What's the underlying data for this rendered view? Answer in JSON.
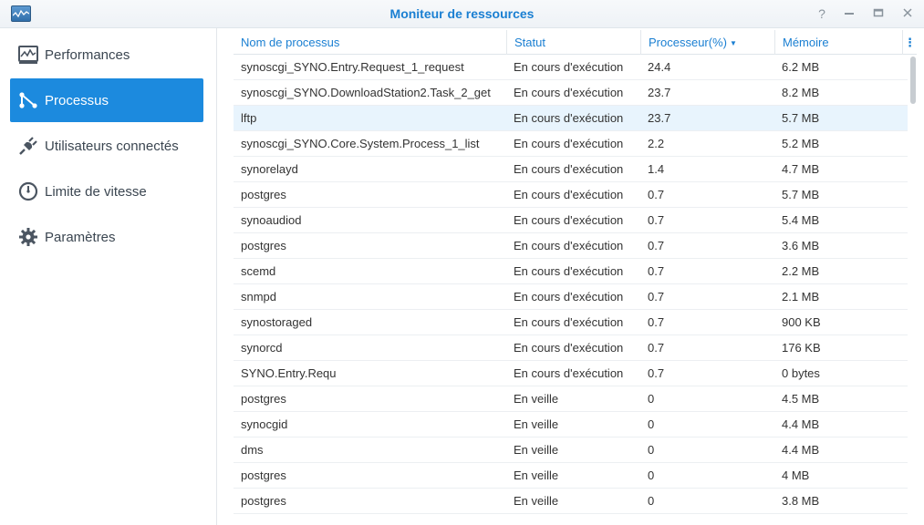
{
  "window": {
    "title": "Moniteur de ressources",
    "controls": [
      "help-icon",
      "minimize-icon",
      "maximize-icon",
      "close-icon"
    ]
  },
  "sidebar": {
    "items": [
      {
        "label": "Performances",
        "icon": "performance-chart-icon",
        "active": false
      },
      {
        "label": "Processus",
        "icon": "process-nodes-icon",
        "active": true
      },
      {
        "label": "Utilisateurs connectés",
        "icon": "plug-icon",
        "active": false
      },
      {
        "label": "Limite de vitesse",
        "icon": "speedometer-icon",
        "active": false
      },
      {
        "label": "Paramètres",
        "icon": "gear-icon",
        "active": false
      }
    ]
  },
  "table": {
    "columns": {
      "name": "Nom de processus",
      "status": "Statut",
      "cpu": "Processeur(%)",
      "memory": "Mémoire",
      "menu": "⋮"
    },
    "sorted_column": "cpu",
    "sort_direction": "descending",
    "rows": [
      {
        "name": "synoscgi_SYNO.Entry.Request_1_request",
        "status": "En cours d'exécution",
        "cpu": "24.4",
        "memory": "6.2 MB"
      },
      {
        "name": "synoscgi_SYNO.DownloadStation2.Task_2_get",
        "status": "En cours d'exécution",
        "cpu": "23.7",
        "memory": "8.2 MB"
      },
      {
        "name": "lftp",
        "status": "En cours d'exécution",
        "cpu": "23.7",
        "memory": "5.7 MB",
        "selected": true
      },
      {
        "name": "synoscgi_SYNO.Core.System.Process_1_list",
        "status": "En cours d'exécution",
        "cpu": "2.2",
        "memory": "5.2 MB"
      },
      {
        "name": "synorelayd",
        "status": "En cours d'exécution",
        "cpu": "1.4",
        "memory": "4.7 MB"
      },
      {
        "name": "postgres",
        "status": "En cours d'exécution",
        "cpu": "0.7",
        "memory": "5.7 MB"
      },
      {
        "name": "synoaudiod",
        "status": "En cours d'exécution",
        "cpu": "0.7",
        "memory": "5.4 MB"
      },
      {
        "name": "postgres",
        "status": "En cours d'exécution",
        "cpu": "0.7",
        "memory": "3.6 MB"
      },
      {
        "name": "scemd",
        "status": "En cours d'exécution",
        "cpu": "0.7",
        "memory": "2.2 MB"
      },
      {
        "name": "snmpd",
        "status": "En cours d'exécution",
        "cpu": "0.7",
        "memory": "2.1 MB"
      },
      {
        "name": "synostoraged",
        "status": "En cours d'exécution",
        "cpu": "0.7",
        "memory": "900 KB"
      },
      {
        "name": "synorcd",
        "status": "En cours d'exécution",
        "cpu": "0.7",
        "memory": "176 KB"
      },
      {
        "name": "SYNO.Entry.Requ",
        "status": "En cours d'exécution",
        "cpu": "0.7",
        "memory": "0 bytes"
      },
      {
        "name": "postgres",
        "status": "En veille",
        "cpu": "0",
        "memory": "4.5 MB"
      },
      {
        "name": "synocgid",
        "status": "En veille",
        "cpu": "0",
        "memory": "4.4 MB"
      },
      {
        "name": "dms",
        "status": "En veille",
        "cpu": "0",
        "memory": "4.4 MB"
      },
      {
        "name": "postgres",
        "status": "En veille",
        "cpu": "0",
        "memory": "4 MB"
      },
      {
        "name": "postgres",
        "status": "En veille",
        "cpu": "0",
        "memory": "3.8 MB"
      }
    ]
  },
  "colors": {
    "accent": "#1a7fd2",
    "active_nav": "#1c8ade",
    "selected_row": "#e8f4fd"
  }
}
